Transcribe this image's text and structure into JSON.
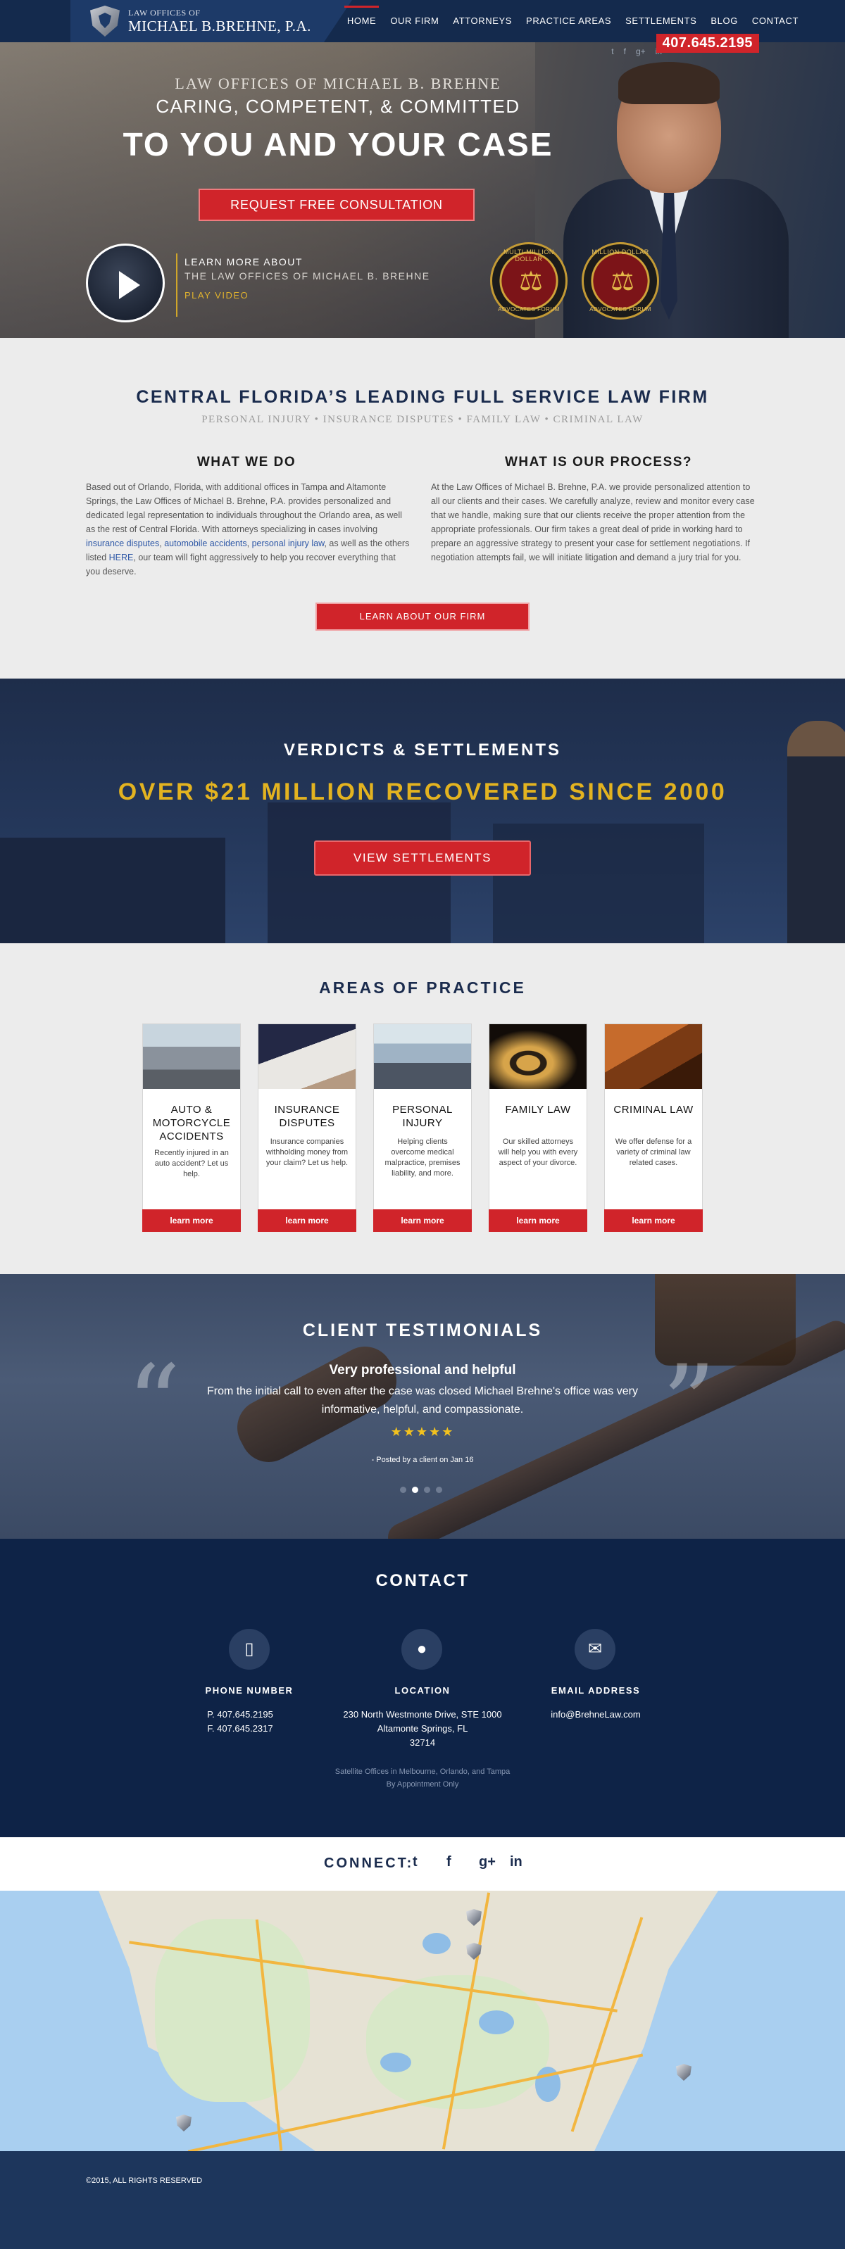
{
  "header": {
    "logo_small": "LAW OFFICES OF",
    "logo_big": "MICHAEL B.BREHNE, P.A.",
    "nav": [
      "HOME",
      "OUR FIRM",
      "ATTORNEYS",
      "PRACTICE AREAS",
      "SETTLEMENTS",
      "BLOG",
      "CONTACT"
    ],
    "phone": "407.645.2195",
    "social": [
      "t",
      "f",
      "g+",
      "in"
    ],
    "accent": "#d0242a"
  },
  "hero": {
    "eyebrow": "LAW OFFICES OF MICHAEL B. BREHNE",
    "sub": "CARING, COMPETENT, & COMMITTED",
    "title": "TO YOU AND YOUR CASE",
    "cta": "REQUEST FREE CONSULTATION",
    "video_learn": "LEARN MORE ABOUT",
    "video_firm": "THE LAW OFFICES OF MICHAEL B. BREHNE",
    "video_play": "PLAY VIDEO",
    "seal_top": "MULTI-MILLION DOLLAR",
    "seal2_top": "MILLION DOLLAR",
    "seal_bottom": "ADVOCATES FORUM"
  },
  "about": {
    "title": "CENTRAL FLORIDA’S LEADING FULL SERVICE LAW FIRM",
    "sub": "PERSONAL INJURY • INSURANCE DISPUTES • FAMILY LAW • CRIMINAL LAW",
    "left_heading": "WHAT WE DO",
    "left_text_1": "Based out of Orlando, Florida, with additional offices in Tampa and Altamonte Springs, the Law Offices of Michael B. Brehne, P.A. provides personalized and dedicated legal representation to individuals throughout the Orlando area, as well as the rest of Central Florida. With attorneys specializing in cases involving ",
    "left_link_1": "insurance disputes",
    "left_sep_1": ", ",
    "left_link_2": "automobile accidents",
    "left_sep_2": ", ",
    "left_link_3": "personal injury law",
    "left_text_2": ", as well as the others listed ",
    "left_link_4": "HERE",
    "left_text_3": ", our team will fight aggressively to help you recover everything that you deserve.",
    "right_heading": "WHAT IS OUR PROCESS?",
    "right_text": "At the Law Offices of Michael B. Brehne, P.A. we provide personalized attention to all our clients and their cases. We carefully analyze, review and monitor every case that we handle, making sure that our clients receive the proper attention from the appropriate professionals. Our firm takes a great deal of pride in working hard to prepare an aggressive strategy to present your case for settlement negotiations. If negotiation attempts fail, we will initiate litigation and demand a jury trial for you.",
    "cta": "LEARN ABOUT OUR FIRM"
  },
  "verdicts": {
    "title": "VERDICTS & SETTLEMENTS",
    "big": "OVER $21 MILLION RECOVERED SINCE 2000",
    "cta": "VIEW SETTLEMENTS",
    "gold": "#e3b320"
  },
  "practice": {
    "title": "AREAS OF PRACTICE",
    "cards": [
      {
        "name": "AUTO & MOTORCYCLE ACCIDENTS",
        "desc": "Recently injured in an auto accident? Let us help.",
        "more": "learn more"
      },
      {
        "name": "INSURANCE DISPUTES",
        "desc": "Insurance companies withholding money from your claim? Let us help.",
        "more": "learn more"
      },
      {
        "name": "PERSONAL INJURY",
        "desc": "Helping clients overcome medical malpractice, premises liability, and more.",
        "more": "learn more"
      },
      {
        "name": "FAMILY LAW",
        "desc": "Our skilled attorneys will help you with every aspect of your divorce.",
        "more": "learn more"
      },
      {
        "name": "CRIMINAL LAW",
        "desc": "We offer defense for a variety of criminal law related cases.",
        "more": "learn more"
      }
    ]
  },
  "testimonials": {
    "title": "CLIENT TESTIMONIALS",
    "heading": "Very professional and helpful",
    "body": "From the initial call to even after the case was closed Michael Brehne's office was very informative, helpful, and compassionate.",
    "stars": "★★★★★",
    "posted": "- Posted by a client  on Jan 16",
    "rating": 5
  },
  "contact": {
    "title": "CONTACT",
    "phone_label": "PHONE NUMBER",
    "phone_p": "P. 407.645.2195",
    "phone_f": "F. 407.645.2317",
    "location_label": "LOCATION",
    "addr1": "230 North Westmonte Drive, STE 1000",
    "addr2": "Altamonte Springs, FL",
    "addr3": "32714",
    "email_label": "EMAIL ADDRESS",
    "email": "info@BrehneLaw.com",
    "note": "Satellite Offices in Melbourne, Orlando, and Tampa By Appointment Only"
  },
  "connect": {
    "label": "CONNECT:",
    "icons": [
      "twitter-icon",
      "facebook-icon",
      "google-plus-icon",
      "linkedin-icon"
    ],
    "glyphs": [
      "t",
      "f",
      "g+",
      "in"
    ]
  },
  "footer": {
    "copyright": "©2015, ALL RIGHTS RESERVED"
  }
}
